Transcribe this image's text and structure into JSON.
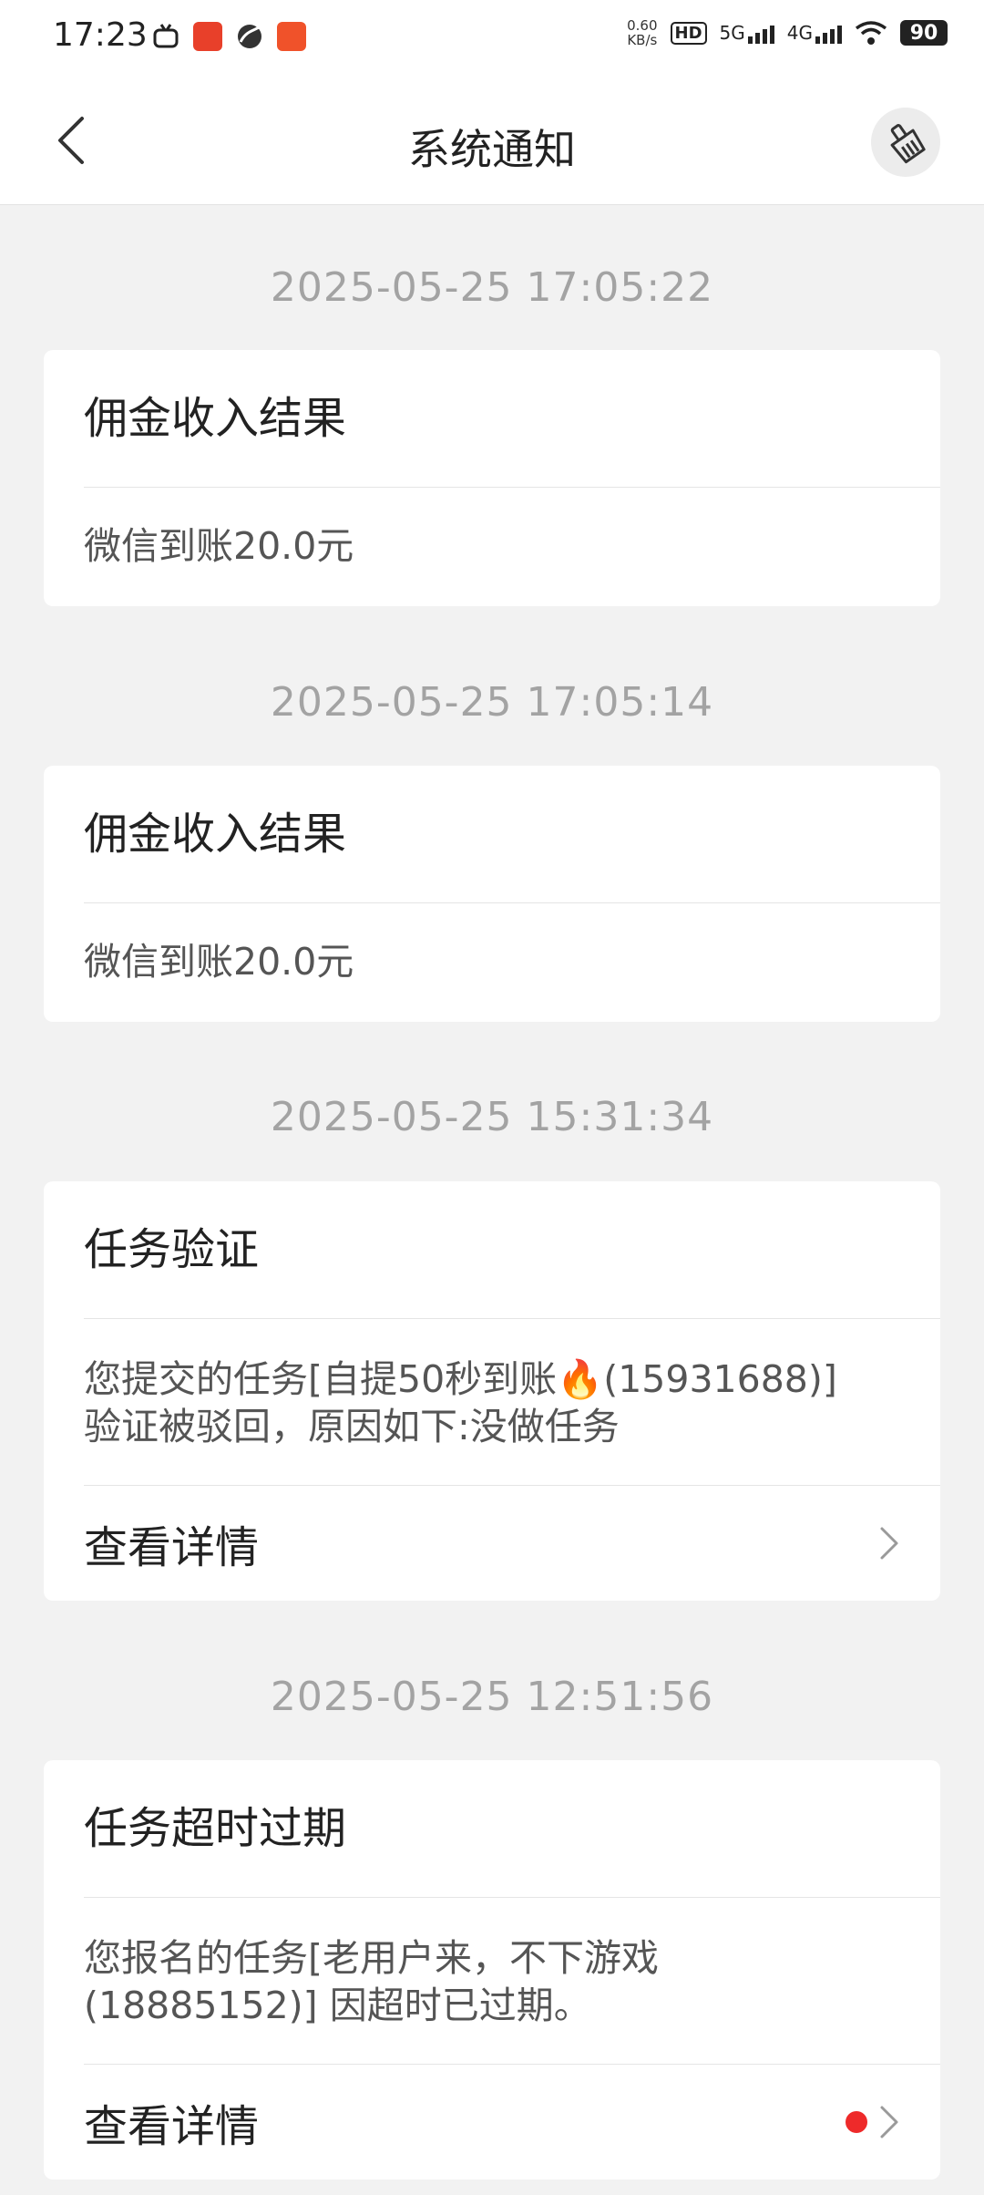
{
  "status_bar": {
    "time": "17:23",
    "net_speed_value": "0.60",
    "net_speed_unit": "KB/s",
    "hd_label": "HD",
    "net1": "5G",
    "net2": "4G",
    "battery": "90"
  },
  "header": {
    "title": "系统通知",
    "back_icon": "chevron-left-icon",
    "clear_icon": "broom-icon"
  },
  "notifications": [
    {
      "timestamp": "2025-05-25 17:05:22",
      "title": "佣金收入结果",
      "body": "微信到账20.0元"
    },
    {
      "timestamp": "2025-05-25 17:05:14",
      "title": "佣金收入结果",
      "body": "微信到账20.0元"
    },
    {
      "timestamp": "2025-05-25 15:31:34",
      "title": "任务验证",
      "body_line1": "您提交的任务[自提50秒到账🔥(15931688)]",
      "body_line2": "验证被驳回，原因如下:没做任务",
      "detail_label": "查看详情"
    },
    {
      "timestamp": "2025-05-25 12:51:56",
      "title": "任务超时过期",
      "body_line1": "您报名的任务[老用户来，不下游戏",
      "body_line2": "(18885152)] 因超时已过期。",
      "detail_label": "查看详情",
      "unread": true
    }
  ],
  "colors": {
    "background": "#f2f2f2",
    "timestamp": "#a3a3a3",
    "unread_dot": "#ee2a2a"
  }
}
